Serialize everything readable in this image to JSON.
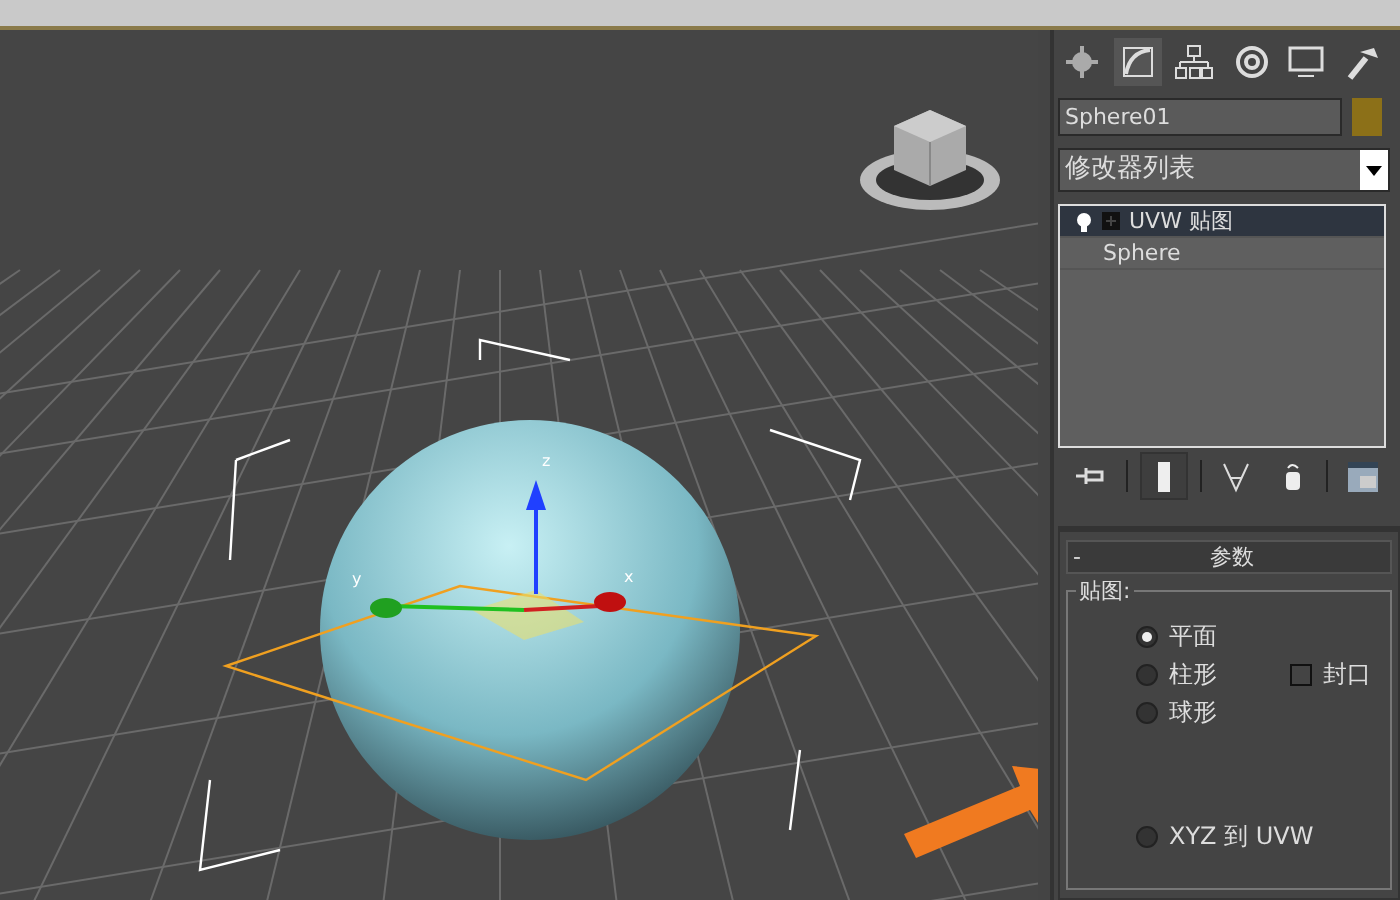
{
  "viewport": {
    "axis_labels": [
      "x",
      "y",
      "z"
    ]
  },
  "command_panel": {
    "tabs": [
      {
        "selected": false
      },
      {
        "selected": true
      },
      {
        "selected": false
      },
      {
        "selected": false
      },
      {
        "selected": false
      },
      {
        "selected": false
      }
    ],
    "object_name": "Sphere01",
    "modifier_list": "修改器列表",
    "stack": [
      {
        "label": "UVW 贴图",
        "kind": "modifier",
        "selected": true
      },
      {
        "label": "Sphere",
        "kind": "base",
        "selected": false
      }
    ],
    "rollout": {
      "collapse": "-",
      "title": "参数",
      "group": "贴图:",
      "options": [
        {
          "label": "平面",
          "selected": true
        },
        {
          "label": "柱形",
          "selected": false
        },
        {
          "label": "球形",
          "selected": false
        }
      ],
      "cap": {
        "label": "封口",
        "checked": false
      },
      "cut_option": {
        "label": "XYZ 到 UVW",
        "selected": false
      }
    }
  }
}
